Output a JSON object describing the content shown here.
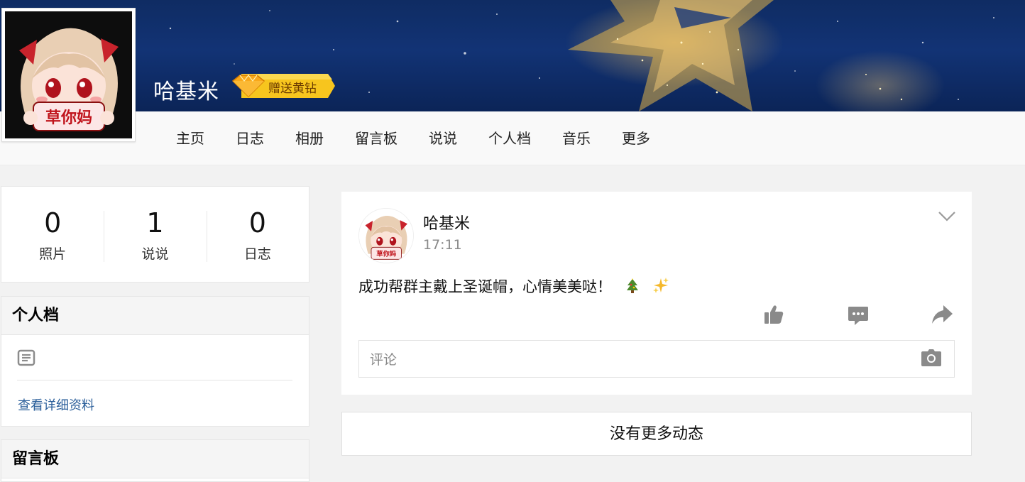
{
  "profile": {
    "name": "哈基米",
    "gift_badge": "赠送黄钻",
    "avatar_sign_text": "草你妈"
  },
  "nav": {
    "items": [
      "主页",
      "日志",
      "相册",
      "留言板",
      "说说",
      "个人档",
      "音乐",
      "更多"
    ]
  },
  "stats": [
    {
      "value": "0",
      "label": "照片"
    },
    {
      "value": "1",
      "label": "说说"
    },
    {
      "value": "0",
      "label": "日志"
    }
  ],
  "profile_card": {
    "title": "个人档",
    "detail_link": "查看详细资料"
  },
  "guestbook_card": {
    "title": "留言板"
  },
  "post": {
    "author": "哈基米",
    "time": "17:11",
    "text": "成功帮群主戴上圣诞帽，心情美美哒！",
    "emoji_icons": [
      "christmas-tree-icon",
      "sparkles-icon"
    ],
    "comment_placeholder": "评论"
  },
  "feed_end": "没有更多动态",
  "colors": {
    "banner": "#123375",
    "link": "#2a5e9a",
    "badge": "#f7c51e"
  }
}
